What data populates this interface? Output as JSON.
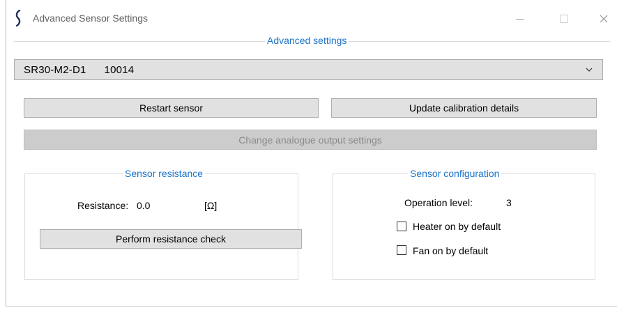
{
  "window": {
    "title": "Advanced Sensor Settings",
    "minimize_glyph": "—",
    "close_glyph": "✕"
  },
  "main_group": {
    "legend": "Advanced settings"
  },
  "device_select": {
    "model": "SR30-M2-D1",
    "serial": "10014"
  },
  "buttons": {
    "restart": "Restart sensor",
    "calibration": "Update calibration details",
    "analogue": "Change analogue output settings",
    "resistance_check": "Perform resistance check"
  },
  "resistance_group": {
    "legend": "Sensor resistance",
    "label": "Resistance:",
    "value": "0.0",
    "unit": "[Ω]"
  },
  "config_group": {
    "legend": "Sensor configuration",
    "operation_label": "Operation level:",
    "operation_value": "3",
    "heater_label": "Heater on by default",
    "heater_checked": false,
    "fan_label": "Fan on by default",
    "fan_checked": false
  },
  "colors": {
    "legend_blue": "#1a73c9",
    "button_face": "#e1e1e1",
    "disabled_face": "#cccccc",
    "icon_navy": "#1f2d5c"
  },
  "icons": {
    "app": "app-logo-icon",
    "dropdown": "chevron-down-icon"
  }
}
